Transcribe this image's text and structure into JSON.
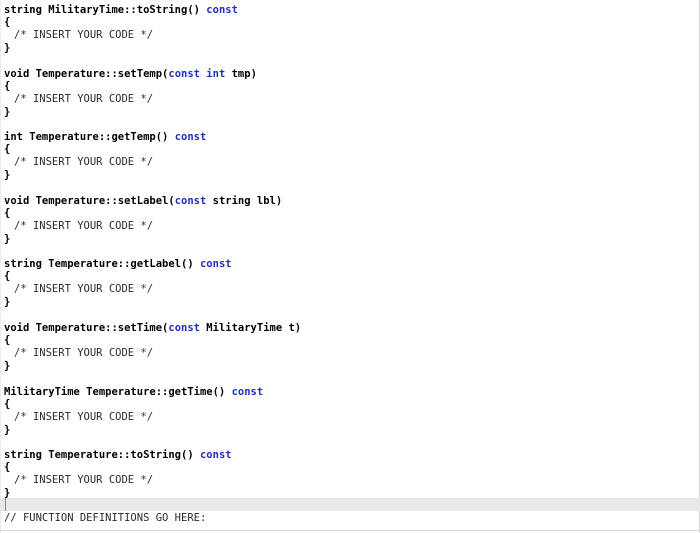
{
  "editor": {
    "blocks": [
      {
        "sig_pre": "string MilitaryTime::toString()",
        "sig_kw": "const",
        "sig_post": "",
        "open": "{",
        "body": "/* INSERT YOUR CODE */",
        "close": "}"
      },
      {
        "sig_pre": "void Temperature::setTemp(",
        "sig_kw": "const int",
        "sig_post": " tmp)",
        "open": "{",
        "body": "/* INSERT YOUR CODE */",
        "close": "}"
      },
      {
        "sig_pre": "int Temperature::getTemp()",
        "sig_kw": "const",
        "sig_post": "",
        "open": "{",
        "body": "/* INSERT YOUR CODE */",
        "close": "}"
      },
      {
        "sig_pre": "void Temperature::setLabel(",
        "sig_kw": "const",
        "sig_post": " string lbl)",
        "open": "{",
        "body": "/* INSERT YOUR CODE */",
        "close": "}"
      },
      {
        "sig_pre": "string Temperature::getLabel()",
        "sig_kw": "const",
        "sig_post": "",
        "open": "{",
        "body": "/* INSERT YOUR CODE */",
        "close": "}"
      },
      {
        "sig_pre": "void Temperature::setTime(",
        "sig_kw": "const",
        "sig_post": " MilitaryTime t)",
        "open": "{",
        "body": "/* INSERT YOUR CODE */",
        "close": "}"
      },
      {
        "sig_pre": "MilitaryTime Temperature::getTime()",
        "sig_kw": "const",
        "sig_post": "",
        "open": "{",
        "body": "/* INSERT YOUR CODE */",
        "close": "}"
      },
      {
        "sig_pre": "string Temperature::toString()",
        "sig_kw": "const",
        "sig_post": "",
        "open": "{",
        "body": "/* INSERT YOUR CODE */",
        "close": "}"
      }
    ],
    "footer_comment": "// FUNCTION DEFINITIONS GO HERE:"
  },
  "colors": {
    "keyword": "#1f2fbf",
    "text": "#000000",
    "comment": "#2b2b2b",
    "current_line": "#e8e8e8"
  }
}
